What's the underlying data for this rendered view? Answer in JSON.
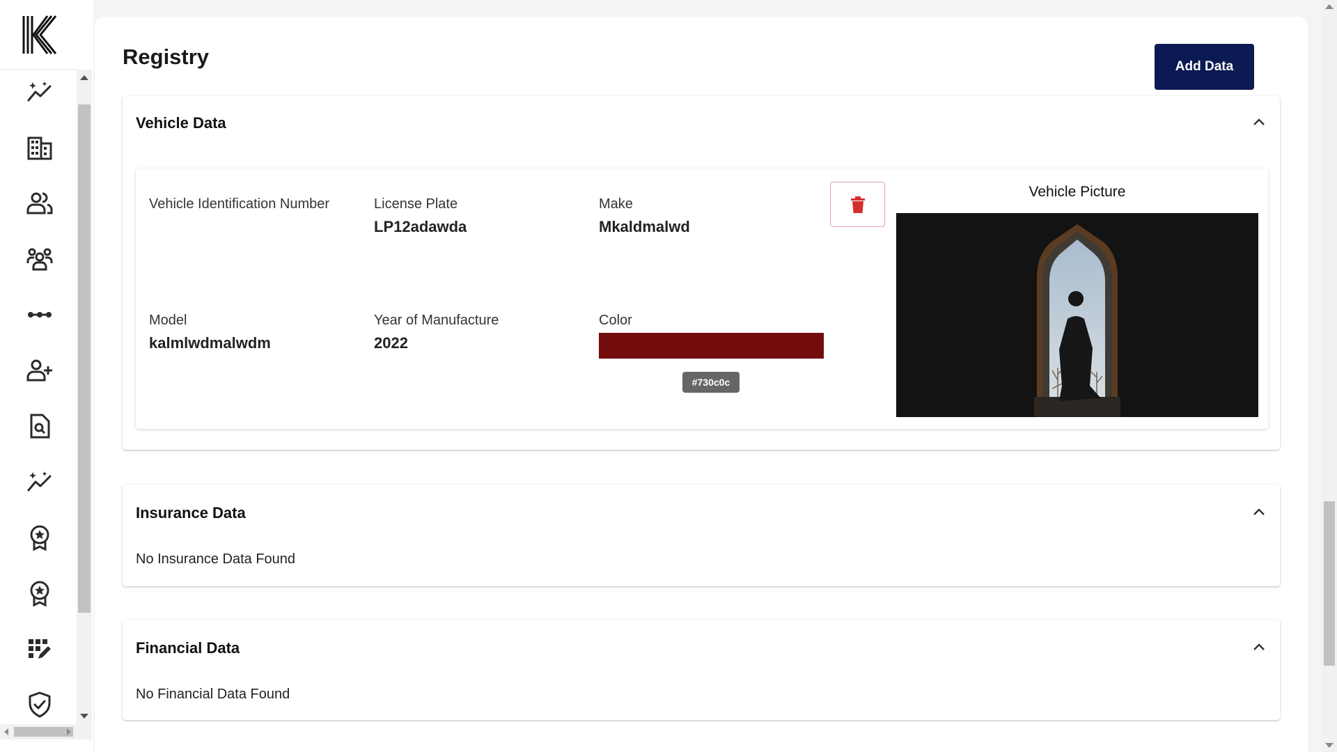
{
  "page": {
    "title": "Registry",
    "add_button": "Add Data"
  },
  "sidebar": {
    "logo_icon": "k-logo-icon",
    "items": [
      {
        "name": "analytics",
        "icon": "trend-sparkle-icon"
      },
      {
        "name": "companies",
        "icon": "building-icon"
      },
      {
        "name": "users",
        "icon": "people-icon"
      },
      {
        "name": "groups",
        "icon": "groups-icon"
      },
      {
        "name": "connections",
        "icon": "dots-line-icon"
      },
      {
        "name": "add-user",
        "icon": "person-add-icon"
      },
      {
        "name": "document-search",
        "icon": "document-search-icon"
      },
      {
        "name": "insights",
        "icon": "trend-sparkle-icon"
      },
      {
        "name": "awards",
        "icon": "badge-star-icon"
      },
      {
        "name": "achievements",
        "icon": "badge-star-icon"
      },
      {
        "name": "grid-edit",
        "icon": "grid-edit-icon"
      },
      {
        "name": "security",
        "icon": "shield-check-icon"
      }
    ]
  },
  "vehicle": {
    "title": "Vehicle Data",
    "fields": {
      "vin_label": "Vehicle Identification Number",
      "vin_value": "",
      "plate_label": "License Plate",
      "plate_value": "LP12adawda",
      "make_label": "Make",
      "make_value": "Mkaldmalwd",
      "model_label": "Model",
      "model_value": "kalmlwdmalwdm",
      "year_label": "Year of Manufacture",
      "year_value": "2022",
      "color_label": "Color",
      "color_hex": "#730c0c"
    },
    "picture_title": "Vehicle Picture",
    "delete_icon": "trash-icon"
  },
  "insurance": {
    "title": "Insurance Data",
    "empty": "No Insurance Data Found"
  },
  "financial": {
    "title": "Financial Data",
    "empty": "No Financial Data Found"
  },
  "colors": {
    "primary": "#0b1a52",
    "danger": "#d32f2f",
    "vehicle_color": "#730c0c"
  }
}
